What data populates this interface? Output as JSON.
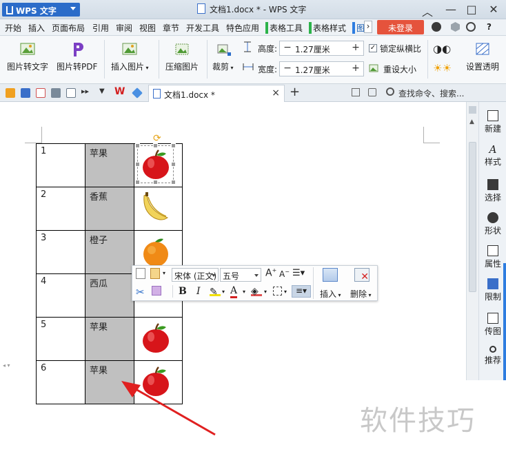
{
  "app": {
    "menu_label": "WPS 文字",
    "window_title": "文档1.docx * - WPS 文字"
  },
  "window_controls": {
    "minimize": "—",
    "restore": "□",
    "close": "✕",
    "collapse": "︿"
  },
  "menubar": {
    "items": [
      "开始",
      "插入",
      "页面布局",
      "引用",
      "审阅",
      "视图",
      "章节",
      "开发工具",
      "特色应用",
      "表格工具",
      "表格样式",
      "图"
    ],
    "more": "›",
    "login": "未登录",
    "help": "?"
  },
  "ribbon": {
    "img_to_text": "图片转文字",
    "img_to_pdf": "图片转PDF",
    "insert_image": "插入图片",
    "compress_image": "压缩图片",
    "crop": "裁剪",
    "height_label": "高度:",
    "height_value": "1.27厘米",
    "width_label": "宽度:",
    "width_value": "1.27厘米",
    "lock_ratio": "锁定纵横比",
    "reset_size": "重设大小",
    "set_transparent": "设置透明",
    "minus": "−",
    "plus": "+"
  },
  "tabbar": {
    "doc_tab": "文档1.docx *",
    "close": "×",
    "new_tab": "+",
    "search_placeholder": "查找命令、搜索..."
  },
  "table": {
    "rows": [
      {
        "num": "1",
        "fruit": "苹果",
        "icon": "apple-icon"
      },
      {
        "num": "2",
        "fruit": "香蕉",
        "icon": "banana-icon"
      },
      {
        "num": "3",
        "fruit": "橙子",
        "icon": "orange-icon"
      },
      {
        "num": "4",
        "fruit": "西瓜",
        "icon": "watermelon-icon"
      },
      {
        "num": "5",
        "fruit": "苹果",
        "icon": "apple-icon"
      },
      {
        "num": "6",
        "fruit": "苹果",
        "icon": "apple-icon"
      }
    ]
  },
  "floating_toolbar": {
    "font_name": "宋体 (正文)",
    "font_size": "五号",
    "bold": "B",
    "italic": "I",
    "font_color_glyph": "A",
    "grow_font": "A",
    "shrink_font": "A",
    "insert": "插入",
    "delete": "删除"
  },
  "sidebar": {
    "items": [
      "新建",
      "样式",
      "选择",
      "形状",
      "属性",
      "限制",
      "传图",
      "推荐"
    ]
  },
  "watermark": "软件技巧",
  "colors": {
    "accent_blue": "#2b6cc9",
    "login_red": "#e5533c",
    "highlight_column": "#c0c0c0",
    "arrow_red": "#e02020"
  }
}
